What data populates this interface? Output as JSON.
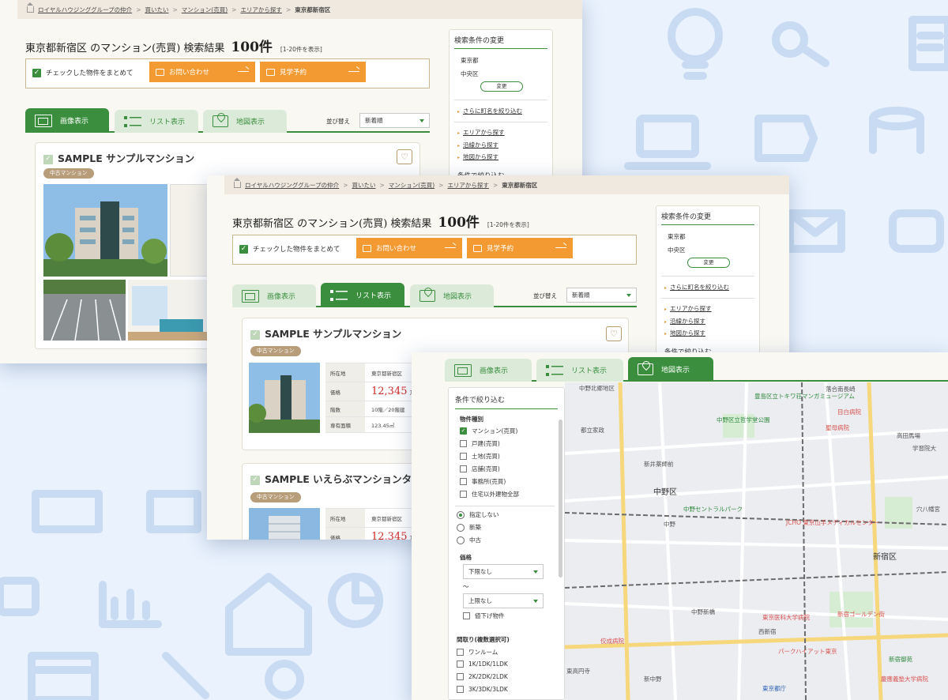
{
  "colors": {
    "accent_green": "#3a8e3e",
    "orange": "#f39a32",
    "price_red": "#cf2b27",
    "badge": "#b79d79",
    "background": "#e9f2fd"
  },
  "breadcrumb": {
    "items": [
      "ロイヤルハウジンググループの仲介",
      "買いたい",
      "マンション(売買)",
      "エリアから探す"
    ],
    "current": "東京都新宿区"
  },
  "result": {
    "title": "東京都新宿区 のマンション(売買) 検索結果",
    "count": "100件",
    "range": "[1-20件を表示]"
  },
  "actions": {
    "bulk_label": "チェックした物件をまとめて",
    "inquiry": "お問い合わせ",
    "visit": "見学予約"
  },
  "tabs": {
    "image": "画像表示",
    "list": "リスト表示",
    "map": "地図表示"
  },
  "sort": {
    "label": "並び替え",
    "value": "新着順"
  },
  "sidebar": {
    "title": "検索条件の変更",
    "pref": "東京都",
    "ward": "中央区",
    "change": "変更",
    "narrow_town": "さらに町名を絞り込む",
    "links": [
      "エリアから探す",
      "沿線から探す",
      "地図から探す"
    ],
    "cut": "条件で絞り込む"
  },
  "listings": [
    {
      "name": "SAMPLE サンプルマンション",
      "badge": "中古マンション",
      "address_label": "所在地",
      "address": "東京都新宿区",
      "price_label": "価格",
      "price": "12,345",
      "price_unit": "万",
      "floor_label": "階数",
      "floor": "10階／20階建",
      "area_label": "専有面積",
      "area": "123.45㎡"
    },
    {
      "name": "SAMPLE いえらぶマンションタワ",
      "badge": "中古マンション",
      "address_label": "所在地",
      "address": "東京都新宿区",
      "price_label": "価格",
      "price": "12,345",
      "price_unit": "万"
    }
  ],
  "filter": {
    "title": "条件で絞り込む",
    "type_label": "物件種別",
    "types": [
      {
        "label": "マンション(売買)",
        "checked": true
      },
      {
        "label": "戸建(売買)",
        "checked": false
      },
      {
        "label": "土地(売買)",
        "checked": false
      },
      {
        "label": "店舗(売買)",
        "checked": false
      },
      {
        "label": "事務所(売買)",
        "checked": false
      },
      {
        "label": "住宅以外建物全部",
        "checked": false
      }
    ],
    "newold": [
      {
        "label": "指定しない",
        "selected": true
      },
      {
        "label": "新築",
        "selected": false
      },
      {
        "label": "中古",
        "selected": false
      }
    ],
    "price_label": "価格",
    "price_min": "下限なし",
    "tilde": "〜",
    "price_max": "上限なし",
    "price_down": "値下げ物件",
    "layout_label": "間取り(複数選択可)",
    "layouts": [
      "ワンルーム",
      "1K/1DK/1LDK",
      "2K/2DK/2LDK",
      "3K/3DK/3LDK"
    ]
  },
  "map_labels": [
    {
      "t": "中野北郷地区",
      "c": ""
    },
    {
      "t": "豊島区立トキワ荘マンガミュージアム",
      "c": "g"
    },
    {
      "t": "落合南長崎",
      "c": ""
    },
    {
      "t": "目白病院",
      "c": "r"
    },
    {
      "t": "都立家政",
      "c": ""
    },
    {
      "t": "中野区立哲学堂公園",
      "c": "g"
    },
    {
      "t": "聖母病院",
      "c": "r"
    },
    {
      "t": "高田馬場",
      "c": ""
    },
    {
      "t": "新井薬師前",
      "c": ""
    },
    {
      "t": "中野区",
      "c": "big"
    },
    {
      "t": "中野セントラルパーク",
      "c": "g"
    },
    {
      "t": "中野",
      "c": ""
    },
    {
      "t": "JCHO 東京山手メディカルセンター",
      "c": "r"
    },
    {
      "t": "新宿区",
      "c": "big"
    },
    {
      "t": "東京医科大学病院",
      "c": "r"
    },
    {
      "t": "新宿ゴールデン街",
      "c": "r"
    },
    {
      "t": "パークハイアット東京",
      "c": "r"
    },
    {
      "t": "佼成病院",
      "c": "r"
    },
    {
      "t": "中野新橋",
      "c": ""
    },
    {
      "t": "東京都庁",
      "c": "b"
    },
    {
      "t": "西新宿",
      "c": ""
    },
    {
      "t": "新宿御苑",
      "c": "g"
    },
    {
      "t": "東高円寺",
      "c": ""
    },
    {
      "t": "新中野",
      "c": ""
    },
    {
      "t": "学習院大",
      "c": ""
    },
    {
      "t": "穴八幡宮",
      "c": ""
    },
    {
      "t": "慶應義塾大学病院",
      "c": "r"
    }
  ]
}
